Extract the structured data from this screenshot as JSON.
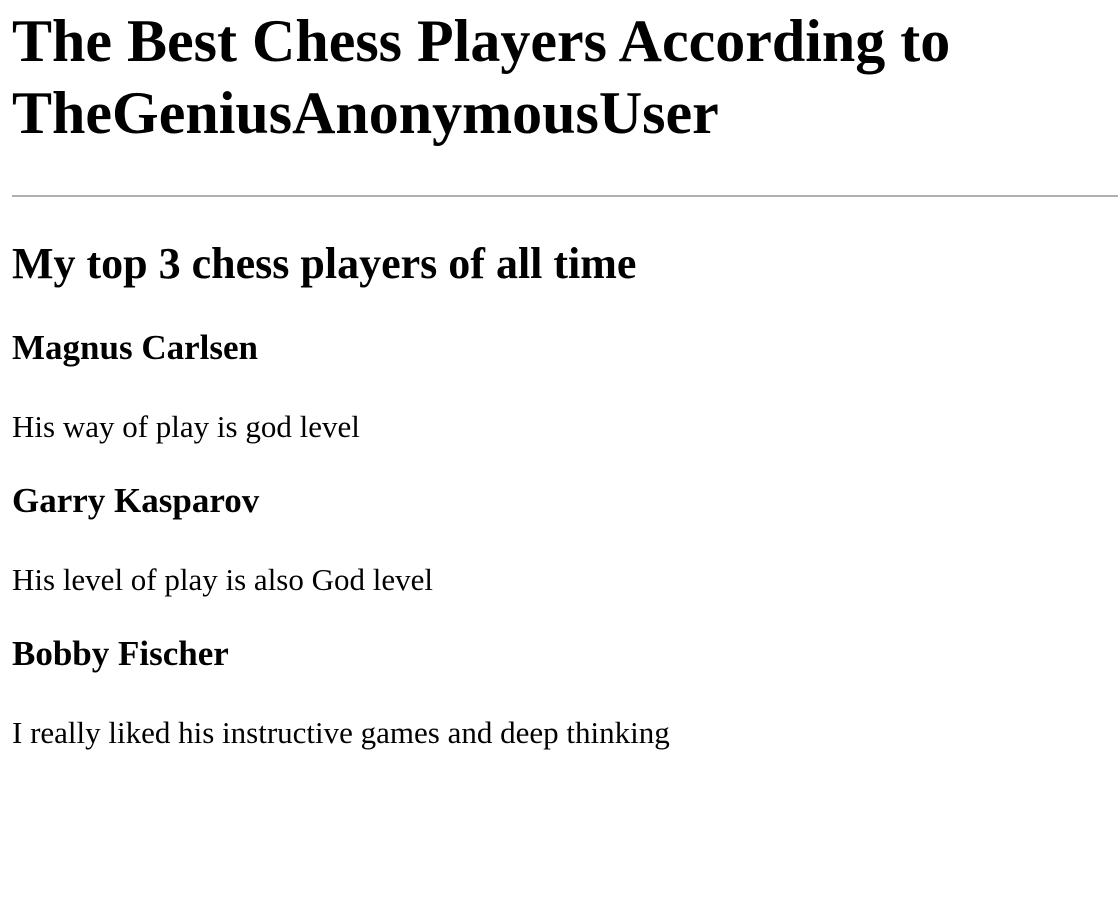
{
  "page": {
    "title": "The Best Chess Players According to TheGeniusAnonymousUser",
    "section_title": "My top 3 chess players of all time",
    "players": [
      {
        "name": "Magnus Carlsen",
        "description": "His way of play is god level"
      },
      {
        "name": "Garry Kasparov",
        "description": "His level of play is also God level"
      },
      {
        "name": "Bobby Fischer",
        "description": "I really liked his instructive games and deep thinking"
      }
    ]
  }
}
